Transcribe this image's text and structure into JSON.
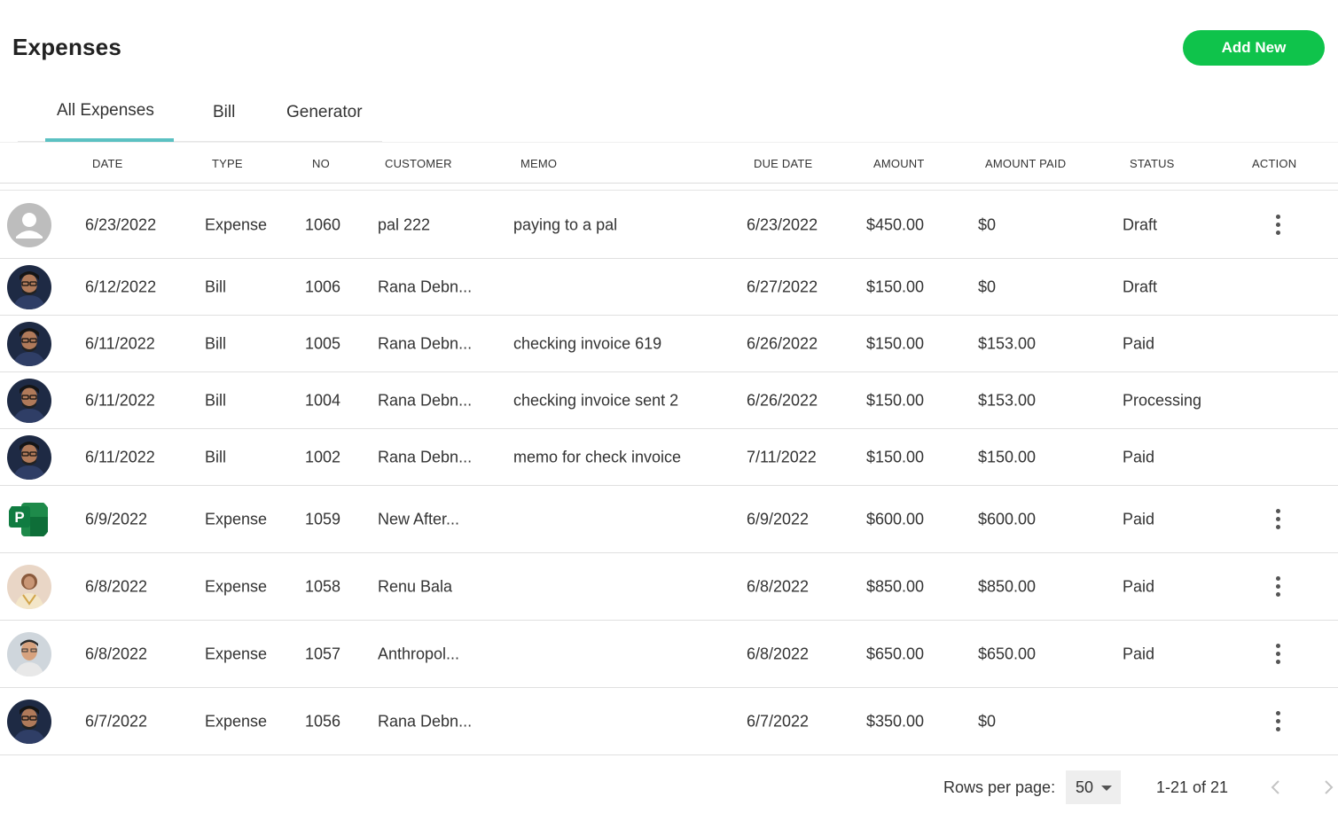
{
  "header": {
    "title": "Expenses",
    "add_button": "Add New",
    "accent_color": "#0fc34b"
  },
  "tabs": [
    {
      "label": "All Expenses",
      "active": true
    },
    {
      "label": "Bill",
      "active": false
    },
    {
      "label": "Generator",
      "active": false
    }
  ],
  "table": {
    "columns": [
      "DATE",
      "TYPE",
      "NO",
      "CUSTOMER",
      "MEMO",
      "DUE DATE",
      "AMOUNT",
      "AMOUNT PAID",
      "STATUS",
      "ACTION"
    ],
    "rows": [
      {
        "avatar": "default-user-icon",
        "date": "6/23/2022",
        "type": "Expense",
        "no": "1060",
        "customer": "pal 222",
        "memo": "paying to a pal",
        "due_date": "6/23/2022",
        "amount": "$450.00",
        "amount_paid": "$0",
        "status": "Draft",
        "has_action": true
      },
      {
        "avatar": "user-photo-rana",
        "date": "6/12/2022",
        "type": "Bill",
        "no": "1006",
        "customer": "Rana Debn...",
        "memo": "",
        "due_date": "6/27/2022",
        "amount": "$150.00",
        "amount_paid": "$0",
        "status": "Draft",
        "has_action": false
      },
      {
        "avatar": "user-photo-rana",
        "date": "6/11/2022",
        "type": "Bill",
        "no": "1005",
        "customer": "Rana Debn...",
        "memo": "checking invoice 619",
        "due_date": "6/26/2022",
        "amount": "$150.00",
        "amount_paid": "$153.00",
        "status": "Paid",
        "has_action": false
      },
      {
        "avatar": "user-photo-rana",
        "date": "6/11/2022",
        "type": "Bill",
        "no": "1004",
        "customer": "Rana Debn...",
        "memo": "checking invoice sent 2",
        "due_date": "6/26/2022",
        "amount": "$150.00",
        "amount_paid": "$153.00",
        "status": "Processing",
        "has_action": false
      },
      {
        "avatar": "user-photo-rana",
        "date": "6/11/2022",
        "type": "Bill",
        "no": "1002",
        "customer": "Rana Debn...",
        "memo": "memo for check invoice",
        "due_date": "7/11/2022",
        "amount": "$150.00",
        "amount_paid": "$150.00",
        "status": "Paid",
        "has_action": false
      },
      {
        "avatar": "project-logo-icon",
        "date": "6/9/2022",
        "type": "Expense",
        "no": "1059",
        "customer": "New After...",
        "memo": "",
        "due_date": "6/9/2022",
        "amount": "$600.00",
        "amount_paid": "$600.00",
        "status": "Paid",
        "has_action": true
      },
      {
        "avatar": "user-photo-renu",
        "date": "6/8/2022",
        "type": "Expense",
        "no": "1058",
        "customer": "Renu Bala",
        "memo": "",
        "due_date": "6/8/2022",
        "amount": "$850.00",
        "amount_paid": "$850.00",
        "status": "Paid",
        "has_action": true
      },
      {
        "avatar": "user-photo-anthro",
        "date": "6/8/2022",
        "type": "Expense",
        "no": "1057",
        "customer": "Anthropol...",
        "memo": "",
        "due_date": "6/8/2022",
        "amount": "$650.00",
        "amount_paid": "$650.00",
        "status": "Paid",
        "has_action": true
      },
      {
        "avatar": "user-photo-rana",
        "date": "6/7/2022",
        "type": "Expense",
        "no": "1056",
        "customer": "Rana Debn...",
        "memo": "",
        "due_date": "6/7/2022",
        "amount": "$350.00",
        "amount_paid": "$0",
        "status": "",
        "has_action": true
      }
    ]
  },
  "pagination": {
    "rows_per_page_label": "Rows per page:",
    "rows_per_page": "50",
    "range": "1-21 of 21"
  }
}
